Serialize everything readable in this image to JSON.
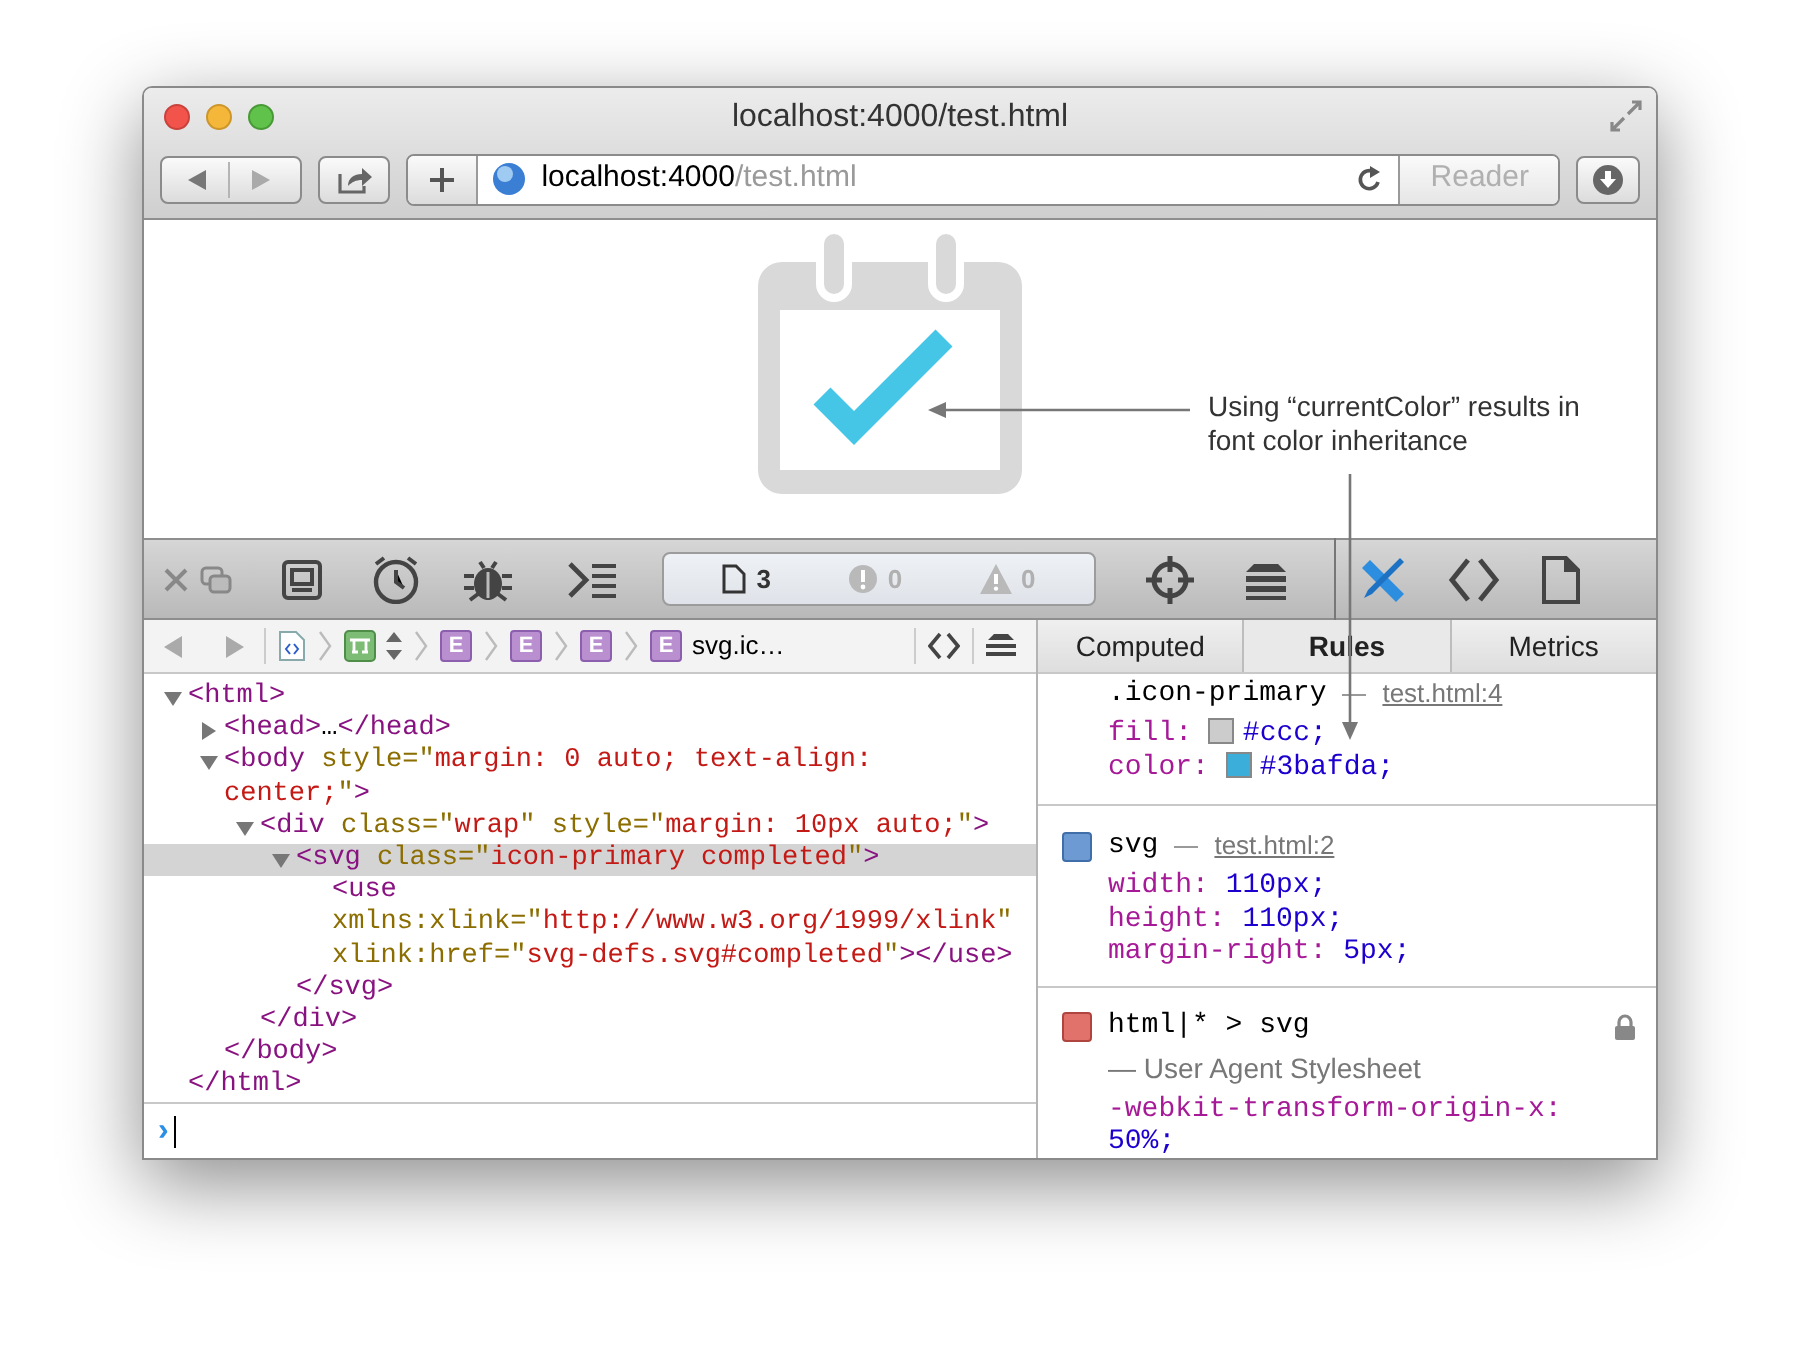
{
  "window": {
    "title": "localhost:4000/test.html"
  },
  "address_bar": {
    "host": "localhost:4000",
    "path": "/test.html",
    "reader": "Reader",
    "reader_disabled": true
  },
  "page": {
    "annotation": "Using “currentColor” results in font color inheritance"
  },
  "devtools_toolbar": {
    "counts": [
      {
        "kind": "resources",
        "text": "3"
      },
      {
        "kind": "errors",
        "text": "0"
      },
      {
        "kind": "warnings",
        "text": "0"
      }
    ]
  },
  "breadcrumb": [
    {
      "kind": "document"
    },
    {
      "kind": "layout"
    },
    {
      "kind": "element",
      "badge": "E"
    },
    {
      "kind": "element",
      "badge": "E"
    },
    {
      "kind": "element",
      "badge": "E"
    },
    {
      "kind": "element",
      "badge": "E",
      "label": "svg.ic…"
    }
  ],
  "sidebar_tabs": [
    {
      "label": "Computed",
      "selected": false
    },
    {
      "label": "Rules",
      "selected": true
    },
    {
      "label": "Metrics",
      "selected": false
    }
  ],
  "dom_tree": [
    {
      "expanded": true,
      "selected": false,
      "open": [
        {
          "kind": "tag",
          "text": "<html>"
        }
      ],
      "close": [
        {
          "kind": "tag",
          "text": "</html>"
        }
      ],
      "children": [
        {
          "expanded": false,
          "selected": false,
          "open": [
            {
              "kind": "tag",
              "text": "<head>"
            },
            {
              "kind": "text",
              "text": "…"
            },
            {
              "kind": "tag",
              "text": "</head>"
            }
          ]
        },
        {
          "expanded": true,
          "selected": false,
          "open": [
            {
              "kind": "tag",
              "text": "<body "
            },
            {
              "kind": "attr",
              "text": "style=\""
            },
            {
              "kind": "value",
              "text": "margin: 0 auto; text-align: center;"
            },
            {
              "kind": "attr",
              "text": "\""
            },
            {
              "kind": "tag",
              "text": ">"
            }
          ],
          "close": [
            {
              "kind": "tag",
              "text": "</body>"
            }
          ],
          "children": [
            {
              "expanded": true,
              "selected": false,
              "open": [
                {
                  "kind": "tag",
                  "text": "<div "
                },
                {
                  "kind": "attr",
                  "text": "class=\""
                },
                {
                  "kind": "value",
                  "text": "wrap"
                },
                {
                  "kind": "attr",
                  "text": "\" style=\""
                },
                {
                  "kind": "value",
                  "text": "margin: 10px auto;"
                },
                {
                  "kind": "attr",
                  "text": "\""
                },
                {
                  "kind": "tag",
                  "text": ">"
                }
              ],
              "close": [
                {
                  "kind": "tag",
                  "text": "</div>"
                }
              ],
              "children": [
                {
                  "expanded": true,
                  "selected": true,
                  "open": [
                    {
                      "kind": "tag",
                      "text": "<svg "
                    },
                    {
                      "kind": "attr",
                      "text": "class=\""
                    },
                    {
                      "kind": "value",
                      "text": "icon-primary completed"
                    },
                    {
                      "kind": "attr",
                      "text": "\""
                    },
                    {
                      "kind": "tag",
                      "text": ">"
                    }
                  ],
                  "close": [
                    {
                      "kind": "tag",
                      "text": "</svg>"
                    }
                  ],
                  "children": [
                    {
                      "selected": false,
                      "open": [
                        {
                          "kind": "tag",
                          "text": "<use "
                        },
                        {
                          "kind": "attr",
                          "text": "xmlns:xlink=\""
                        },
                        {
                          "kind": "value",
                          "text": "http://www.w3.org/1999/xlink"
                        },
                        {
                          "kind": "attr",
                          "text": "\" xlink:href=\""
                        },
                        {
                          "kind": "value",
                          "text": "svg-defs.svg#completed"
                        },
                        {
                          "kind": "attr",
                          "text": "\""
                        },
                        {
                          "kind": "tag",
                          "text": "></use>"
                        }
                      ]
                    }
                  ]
                }
              ]
            }
          ]
        }
      ]
    }
  ],
  "rules": [
    {
      "selector": ".icon-primary",
      "source": "test.html:4",
      "properties": [
        {
          "name": "fill:",
          "value": "#ccc;",
          "color": "#cccccc"
        },
        {
          "name": "color:",
          "value": "#3bafda;",
          "color": "#3bafda"
        }
      ]
    },
    {
      "kind": "author",
      "selector": "svg",
      "source": "test.html:2",
      "properties": [
        {
          "name": "width:",
          "value": "110px;"
        },
        {
          "name": "height:",
          "value": "110px;"
        },
        {
          "name": "margin-right:",
          "value": "5px;"
        }
      ]
    },
    {
      "kind": "user-agent",
      "selector": "html|* > svg",
      "origin": "— User Agent Stylesheet",
      "locked": true,
      "properties": [
        {
          "name": "-webkit-transform-origin-x:",
          "value": "50%;"
        }
      ]
    }
  ],
  "console": {
    "prompt": "›"
  }
}
